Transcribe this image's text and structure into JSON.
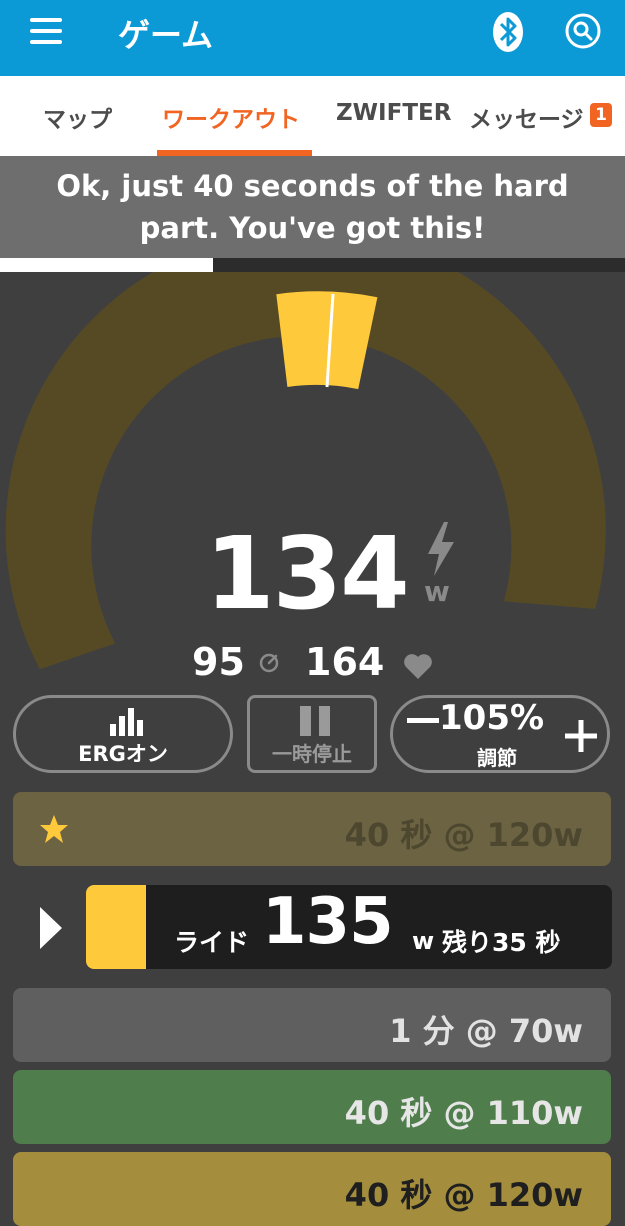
{
  "header": {
    "title": "ゲーム"
  },
  "tabs": [
    {
      "label": "マップ"
    },
    {
      "label": "ワークアウト"
    },
    {
      "label": "ZWIFTER"
    },
    {
      "label": "メッセージ"
    }
  ],
  "messages_badge": "1",
  "coach_message": "Ok, just 40 seconds of the hard part. You've got this!",
  "workout_progress": 0.34,
  "power": {
    "value": "134",
    "unit": "w"
  },
  "cadence": "95",
  "heart_rate": "164",
  "controls": {
    "erg_label": "ERGオン",
    "pause_label": "一時停止",
    "adjust_value": "105%",
    "adjust_label": "調節"
  },
  "intervals": {
    "previous": "40 秒 @ 120w",
    "current": {
      "prefix": "ライド",
      "target": "135",
      "unit": "w",
      "remaining": "残り35 秒"
    },
    "next": [
      "1 分 @ 70w",
      "40 秒 @ 110w",
      "40 秒 @ 120w"
    ]
  },
  "colors": {
    "header": "#0b9ad6",
    "accent": "#f16421",
    "gauge_band": "#564a25",
    "gauge_target": "#ffc93c"
  }
}
